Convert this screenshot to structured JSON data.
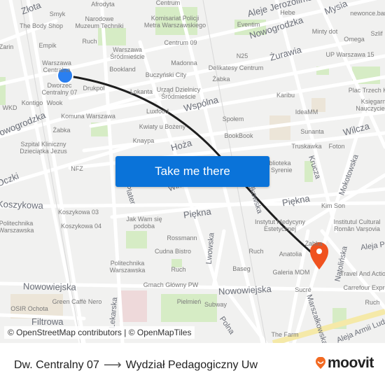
{
  "map": {
    "streets": [
      {
        "name": "Złota"
      },
      {
        "name": "Aleje Jerozolimskie"
      },
      {
        "name": "Nowogrodzka"
      },
      {
        "name": "Mysia"
      },
      {
        "name": "Żurawia"
      },
      {
        "name": "Wspólna"
      },
      {
        "name": "Nowogrodzka"
      },
      {
        "name": "Hoża"
      },
      {
        "name": "Wilcza"
      },
      {
        "name": "Krucza"
      },
      {
        "name": "Mokotowska"
      },
      {
        "name": "Marszałkowska"
      },
      {
        "name": "Emilii Plater"
      },
      {
        "name": "Lwowska"
      },
      {
        "name": "Piękna"
      },
      {
        "name": "Piękna"
      },
      {
        "name": "Koszykowa"
      },
      {
        "name": "Nowowiejska"
      },
      {
        "name": "Nowowiejska"
      },
      {
        "name": "Polna"
      },
      {
        "name": "Lekarska"
      },
      {
        "name": "Filtrowa"
      },
      {
        "name": "Natolińska"
      },
      {
        "name": "Marszałkowska"
      },
      {
        "name": "Aleja Armii Ludowej"
      },
      {
        "name": "Aleja Przyjaciół"
      },
      {
        "name": "Oczki"
      },
      {
        "name": "Wilcza"
      }
    ],
    "pois": [
      {
        "name": "Afrodyta"
      },
      {
        "name": "Smyk"
      },
      {
        "name": "The Body Shop"
      },
      {
        "name": "Narodowe\nMuzeum Techniki"
      },
      {
        "name": "Empik"
      },
      {
        "name": "Zarin"
      },
      {
        "name": "Ruch"
      },
      {
        "name": "Warszawa\nŚródmieście"
      },
      {
        "name": "Warszawa\nCentralna"
      },
      {
        "name": "Dworzec\nCentralny 07"
      },
      {
        "name": "Bookland"
      },
      {
        "name": "Drukpol"
      },
      {
        "name": "Kontigo"
      },
      {
        "name": "Wook"
      },
      {
        "name": "WKD"
      },
      {
        "name": "Centrum"
      },
      {
        "name": "Komisariat Policji\nMetra Warszawskiego"
      },
      {
        "name": "Centrum 09"
      },
      {
        "name": "Madonna"
      },
      {
        "name": "Buczyński City"
      },
      {
        "name": "Lokanta"
      },
      {
        "name": "Urząd Dzielnicy\nŚródmieście"
      },
      {
        "name": "Eventim"
      },
      {
        "name": "N25"
      },
      {
        "name": "Delikatesy Centrum"
      },
      {
        "name": "Żabka"
      },
      {
        "name": "Hebe"
      },
      {
        "name": "newonce.bar"
      },
      {
        "name": "Minty dot"
      },
      {
        "name": "Omega"
      },
      {
        "name": "Szlif"
      },
      {
        "name": "UP Warszawa 15"
      },
      {
        "name": "Plac Trzech Krzyży"
      },
      {
        "name": "Księgarnia\nNauczycielska"
      },
      {
        "name": "Karibu"
      },
      {
        "name": "IdeaMM"
      },
      {
        "name": "Komuna Warszawa"
      },
      {
        "name": "Żabka"
      },
      {
        "name": "Luxfood"
      },
      {
        "name": "Kwiaty u Bożeny"
      },
      {
        "name": "Społem"
      },
      {
        "name": "BookBook"
      },
      {
        "name": "Sunanta"
      },
      {
        "name": "Truskawka"
      },
      {
        "name": "Foton"
      },
      {
        "name": "Szpital Kliniczny\nDzieciątka Jezus"
      },
      {
        "name": "Knaypa"
      },
      {
        "name": "NFZ"
      },
      {
        "name": "Biblioteka\nna Syrenie"
      },
      {
        "name": "Kim Son"
      },
      {
        "name": "Koszykowa 03"
      },
      {
        "name": "Koszykowa 04"
      },
      {
        "name": "Jak Wam się\npodoba"
      },
      {
        "name": "Politechnika\nWarszawska"
      },
      {
        "name": "Rossmann"
      },
      {
        "name": "Instytut Medycyny\nEstetycznej"
      },
      {
        "name": "Institutul Cultural\nRomân Varșovia"
      },
      {
        "name": "Żabka"
      },
      {
        "name": "Anatolia"
      },
      {
        "name": "Cudna Bistro"
      },
      {
        "name": "Politechnika\nWarszawska"
      },
      {
        "name": "Ruch"
      },
      {
        "name": "Ruch"
      },
      {
        "name": "Baseg"
      },
      {
        "name": "Galeria MDM"
      },
      {
        "name": "Travel And Action"
      },
      {
        "name": "Carrefour Express"
      },
      {
        "name": "Gmach Główny PW"
      },
      {
        "name": "Sucré"
      },
      {
        "name": "Ruch"
      },
      {
        "name": "Green Caffè Nero"
      },
      {
        "name": "Pielmień"
      },
      {
        "name": "Subway"
      },
      {
        "name": "OSIR Ochota"
      },
      {
        "name": "The Farm"
      }
    ],
    "origin_marker": {
      "label": "Dworzec Centralny 07",
      "color": "#2a7ff0"
    },
    "destination_marker": {
      "label": "Wydział Pedagogiczny Uw",
      "color": "#f0521f"
    },
    "route_color": "#1e1e1e"
  },
  "cta": {
    "label": "Take me there"
  },
  "attribution": "© OpenStreetMap contributors | © OpenMapTiles",
  "footer": {
    "origin": "Dw. Centralny 07",
    "arrow": "⟶",
    "destination": "Wydział Pedagogiczny Uw",
    "brand": "moovit",
    "brand_color": "#f26a22"
  }
}
